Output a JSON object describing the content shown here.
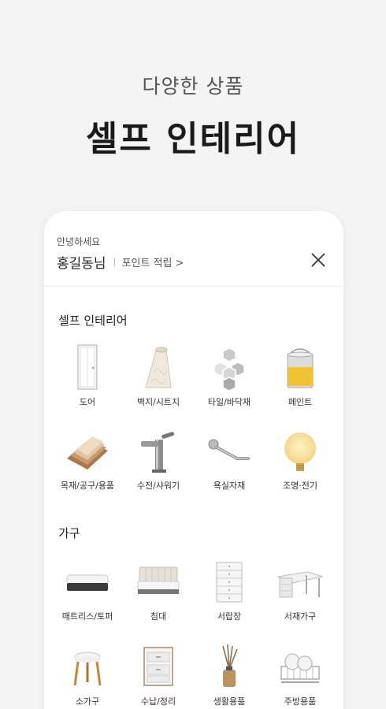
{
  "promo": {
    "subtitle": "다양한 상품",
    "title": "셀프 인테리어"
  },
  "header": {
    "greeting": "안녕하세요",
    "user_name": "홍길동님",
    "point_link": "포인트 적립 >",
    "close_icon": "close-icon"
  },
  "sections": [
    {
      "title": "셀프 인테리어",
      "categories": [
        {
          "label": "도어",
          "icon": "door-icon"
        },
        {
          "label": "벽지/시트지",
          "icon": "wallpaper-roll-icon"
        },
        {
          "label": "타일/바닥재",
          "icon": "hexagon-tiles-icon"
        },
        {
          "label": "페인트",
          "icon": "paint-bucket-icon"
        },
        {
          "label": "목재/공구/용품",
          "icon": "wood-planks-icon"
        },
        {
          "label": "수전/샤워기",
          "icon": "faucet-icon"
        },
        {
          "label": "욕실자재",
          "icon": "towel-bar-icon"
        },
        {
          "label": "조명·전기",
          "icon": "light-bulb-icon"
        }
      ]
    },
    {
      "title": "가구",
      "categories": [
        {
          "label": "매트리스/토퍼",
          "icon": "mattress-icon"
        },
        {
          "label": "침대",
          "icon": "bed-icon"
        },
        {
          "label": "서랍장",
          "icon": "drawer-chest-icon"
        },
        {
          "label": "서재가구",
          "icon": "desk-icon"
        },
        {
          "label": "소가구",
          "icon": "stool-icon"
        },
        {
          "label": "수납/정리",
          "icon": "storage-box-icon"
        },
        {
          "label": "생활용품",
          "icon": "diffuser-icon"
        },
        {
          "label": "주방용품",
          "icon": "dish-rack-icon"
        }
      ]
    }
  ]
}
